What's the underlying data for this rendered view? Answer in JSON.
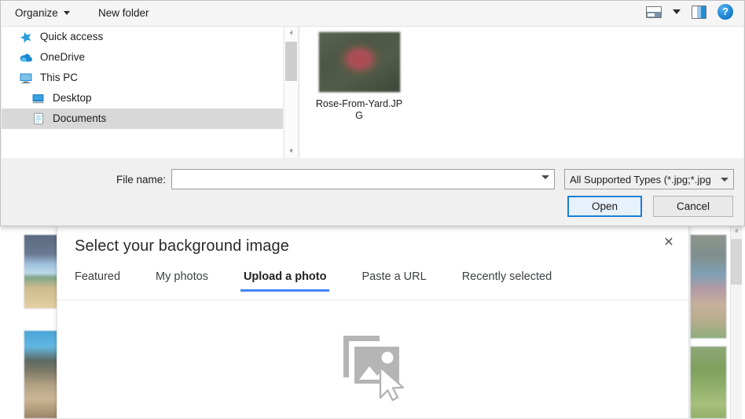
{
  "explorer": {
    "toolbar": {
      "organize_label": "Organize",
      "new_folder_label": "New folder",
      "view_icon": "view-layout-icon",
      "view_caret_icon": "chevron-down-icon",
      "preview_pane_icon": "preview-pane-icon",
      "help_icon": "help-icon",
      "help_glyph": "?"
    },
    "nav_items": [
      {
        "label": "Quick access",
        "icon": "star-icon",
        "indent": false,
        "selected": false
      },
      {
        "label": "OneDrive",
        "icon": "cloud-icon",
        "indent": false,
        "selected": false
      },
      {
        "label": "This PC",
        "icon": "monitor-icon",
        "indent": false,
        "selected": false
      },
      {
        "label": "Desktop",
        "icon": "desktop-folder-icon",
        "indent": true,
        "selected": false
      },
      {
        "label": "Documents",
        "icon": "documents-icon",
        "indent": true,
        "selected": true
      }
    ],
    "scrollbar": {
      "up_glyph": "ⱏ",
      "down_glyph": "ⱝ"
    },
    "files": [
      {
        "name": "Rose-From-Yard.JPG",
        "thumb": "rose-photo-thumbnail"
      }
    ],
    "form": {
      "filename_label": "File name:",
      "filename_value": "",
      "filename_placeholder": "",
      "filetype_value": "All Supported Types (*.jpg;*.jpg",
      "open_label": "Open",
      "cancel_label": "Cancel"
    }
  },
  "picker": {
    "title": "Select your background image",
    "close_glyph": "✕",
    "tabs": [
      {
        "label": "Featured",
        "active": false
      },
      {
        "label": "My photos",
        "active": false
      },
      {
        "label": "Upload a photo",
        "active": true
      },
      {
        "label": "Paste a URL",
        "active": false
      },
      {
        "label": "Recently selected",
        "active": false
      }
    ],
    "upload_icon": "upload-photos-cursor-icon",
    "accent_color": "#4285f4"
  },
  "background": {
    "thumbnails": [
      {
        "name": "beach-sky-thumbnail-left-top"
      },
      {
        "name": "rocky-shore-thumbnail-left-bottom"
      },
      {
        "name": "landscape-thumbnail-right-top"
      },
      {
        "name": "green-leaf-thumbnail-right-bottom"
      }
    ],
    "signal_icon": "signal-bars-icon",
    "scrollbar_up_glyph": "ⱏ"
  }
}
